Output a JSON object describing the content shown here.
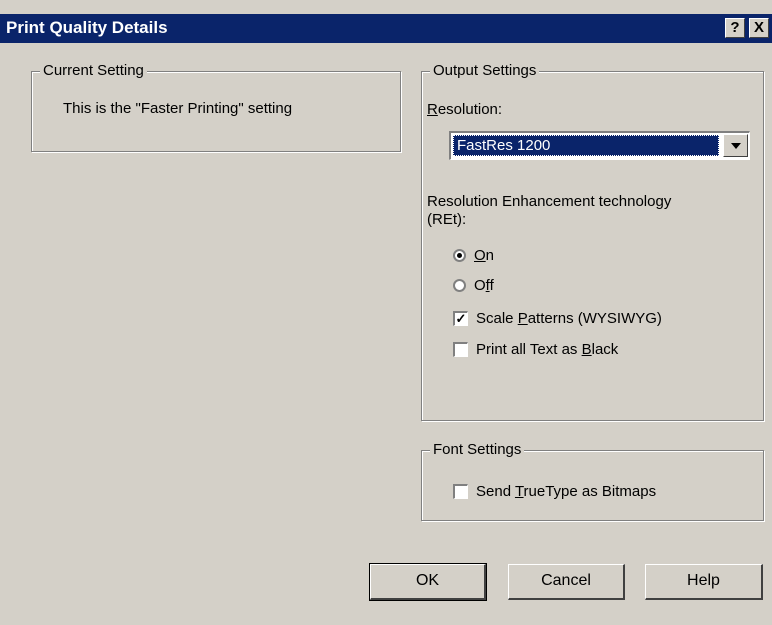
{
  "window": {
    "title": "Print Quality Details",
    "help_label": "?",
    "close_label": "X"
  },
  "current_setting": {
    "legend": "Current Setting",
    "text": "This is the \"Faster Printing\" setting"
  },
  "output_settings": {
    "legend": "Output Settings",
    "resolution_label_u": "R",
    "resolution_label_rest": "esolution:",
    "resolution_value": "FastRes 1200",
    "ret_label_line1": "Resolution Enhancement technology",
    "ret_label_line2": "(REt):",
    "radio_on_u": "O",
    "radio_on_rest": "n",
    "radio_off_pre": "O",
    "radio_off_u": "f",
    "radio_off_rest": "f",
    "radio_selected": "On",
    "scale_patterns_pre": "Scale ",
    "scale_patterns_u": "P",
    "scale_patterns_rest": "atterns (WYSIWYG)",
    "scale_patterns_checked": true,
    "print_black_pre": "Print all Text as ",
    "print_black_u": "B",
    "print_black_rest": "lack",
    "print_black_checked": false
  },
  "font_settings": {
    "legend": "Font Settings",
    "send_truetype_pre": "Send ",
    "send_truetype_u": "T",
    "send_truetype_rest": "rueType as Bitmaps",
    "send_truetype_checked": false
  },
  "buttons": {
    "ok": "OK",
    "cancel": "Cancel",
    "help": "Help"
  }
}
